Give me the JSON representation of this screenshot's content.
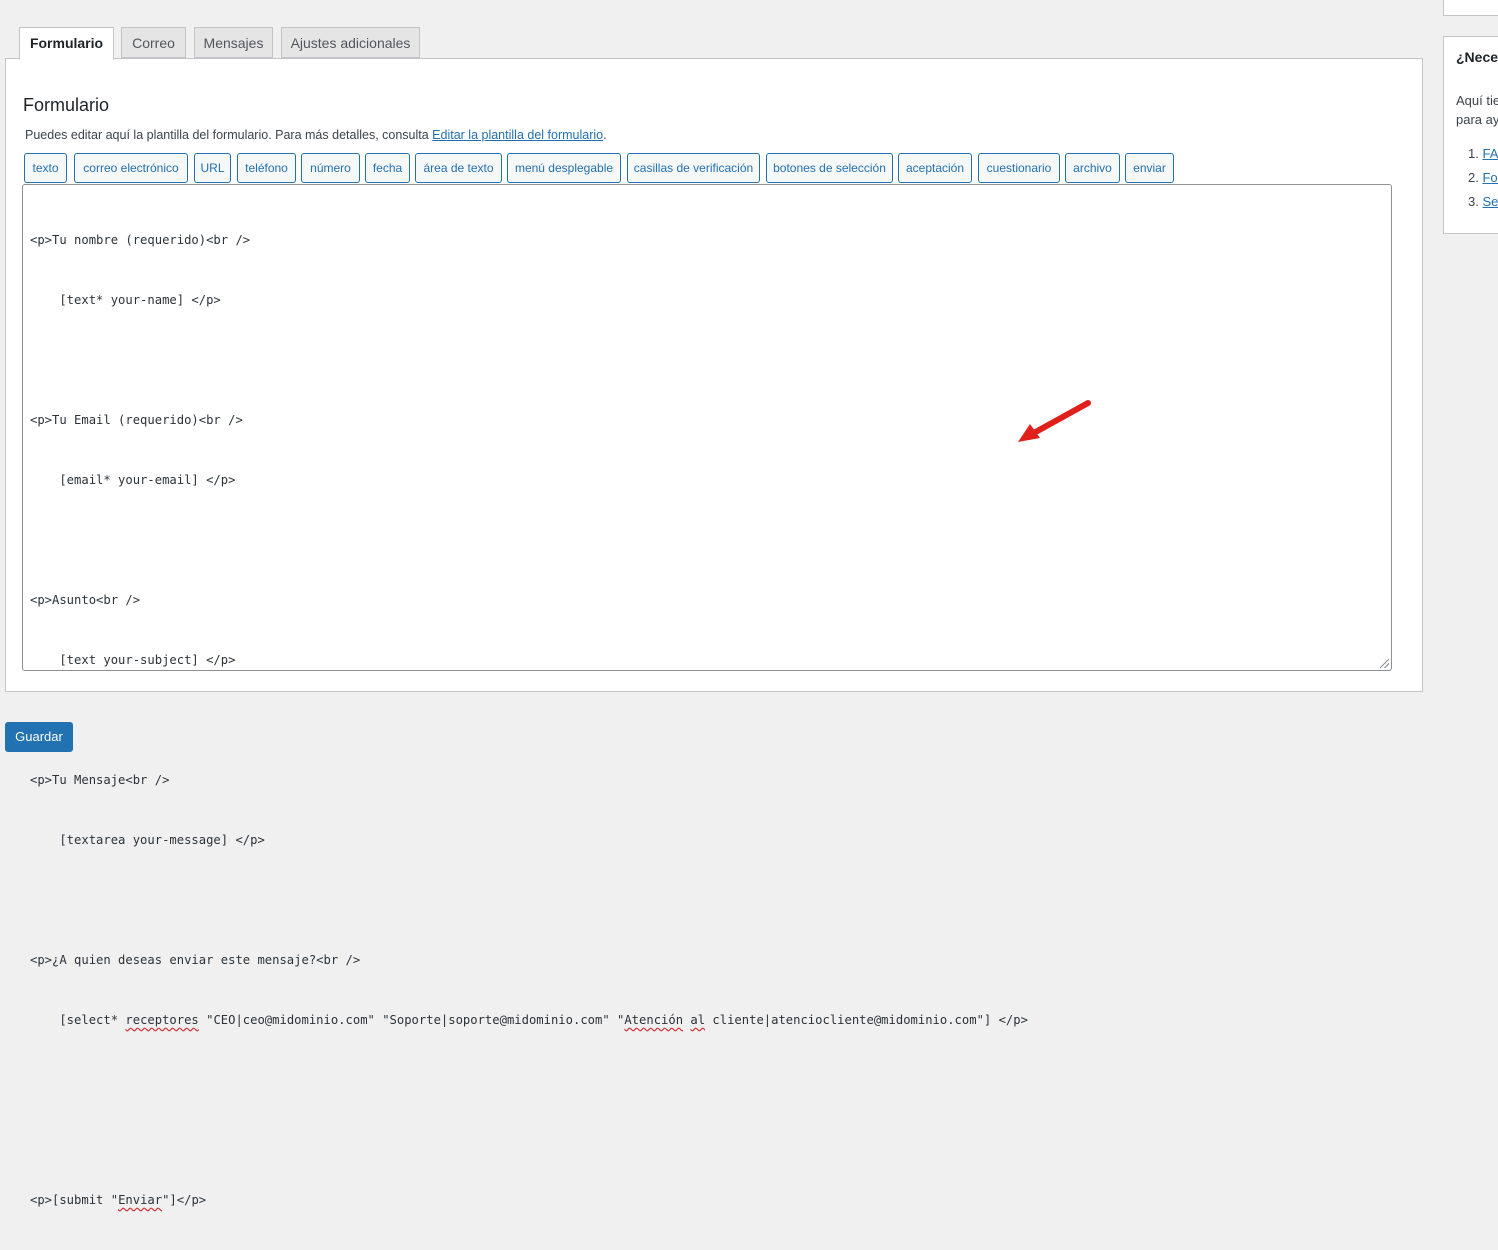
{
  "tabs": [
    "Formulario",
    "Correo",
    "Mensajes",
    "Ajustes adicionales"
  ],
  "panel": {
    "title": "Formulario",
    "description": "Puedes editar aquí la plantilla del formulario. Para más detalles, consulta ",
    "description_link": "Editar la plantilla del formulario",
    "description_end": "."
  },
  "tag_buttons": [
    "texto",
    "correo electrónico",
    "URL",
    "teléfono",
    "número",
    "fecha",
    "área de texto",
    "menú desplegable",
    "casillas de verificación",
    "botones de selección",
    "aceptación",
    "cuestionario",
    "archivo",
    "enviar"
  ],
  "editor": {
    "lines": [
      [
        "<p>Tu nombre (requerido)<br />"
      ],
      [
        "    [text* your-name] </p>"
      ],
      [
        ""
      ],
      [
        "<p>Tu Email (requerido)<br />"
      ],
      [
        "    [email* your-email] </p>"
      ],
      [
        ""
      ],
      [
        "<p>Asunto<br />"
      ],
      [
        "    [text your-subject] </p>"
      ],
      [
        ""
      ],
      [
        "<p>Tu Mensaje<br />"
      ],
      [
        "    [textarea your-message] </p>"
      ],
      [
        ""
      ],
      [
        "<p>¿A quien deseas enviar este mensaje?<br />"
      ],
      [
        "    [select* ",
        "receptores",
        " \"CEO|ceo@midominio.com\" \"Soporte|soporte@midominio.com\" \"",
        "Atención",
        " ",
        "al",
        " cliente|atenciocliente@midominio.com\"] </p>"
      ],
      [
        ""
      ],
      [
        ""
      ],
      [
        "<p>[submit \"",
        "Enviar",
        "\"]</p>"
      ]
    ]
  },
  "save_button": "Guardar",
  "sidebar": {
    "title": "¿Neces",
    "text_lines": [
      "Aquí tie",
      "para ay"
    ],
    "links": [
      "FAQ",
      "For",
      "Ser"
    ]
  },
  "colors": {
    "accent": "#2271b1",
    "annotation_arrow": "#e0201b"
  }
}
